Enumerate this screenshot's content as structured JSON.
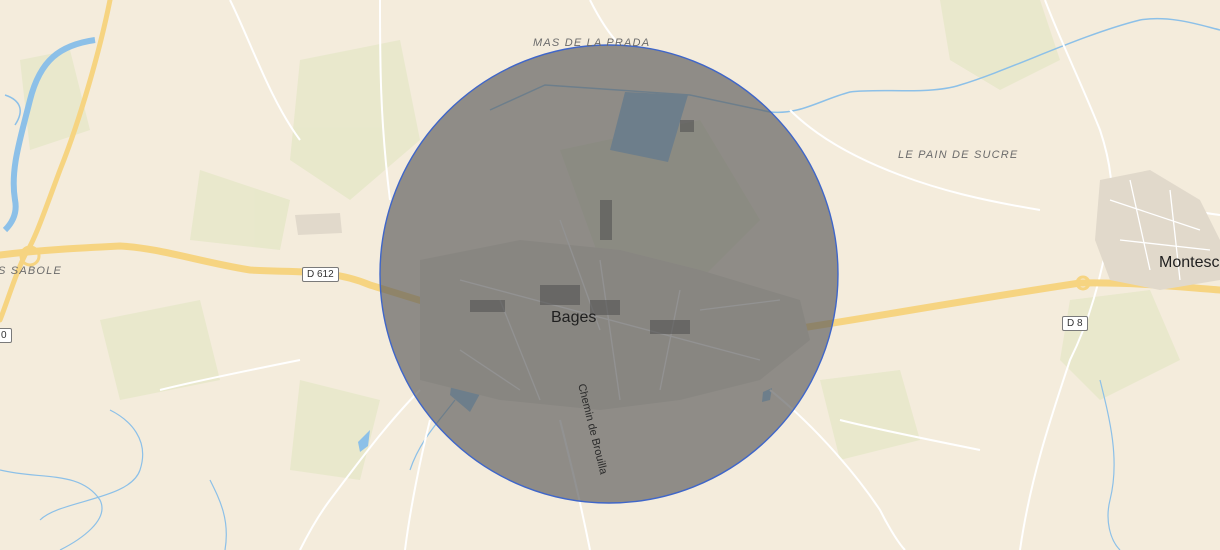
{
  "map": {
    "colors": {
      "land": "#f4ecdc",
      "green": "#e3e7c8",
      "water": "#8cc0e8",
      "major_road": "#f6d481",
      "minor_road": "#ffffff",
      "circle_fill": "#5e5e5e",
      "circle_stroke": "#3f66c9"
    },
    "places": {
      "bages": "Bages",
      "montescot": "Montesc",
      "mas_de_la_prada": "MAS DE LA PRADA",
      "le_pain_de_sucre": "LE PAIN DE SUCRE",
      "sabole": "S SABOLE"
    },
    "roads": {
      "d612": "D 612",
      "d8": "D 8",
      "left_edge_shield": "0"
    },
    "streets": {
      "chemin_de_brouilla": "Chemin de Brouilla"
    },
    "overlay": {
      "shape": "circle",
      "centered_on": "Bages"
    }
  }
}
